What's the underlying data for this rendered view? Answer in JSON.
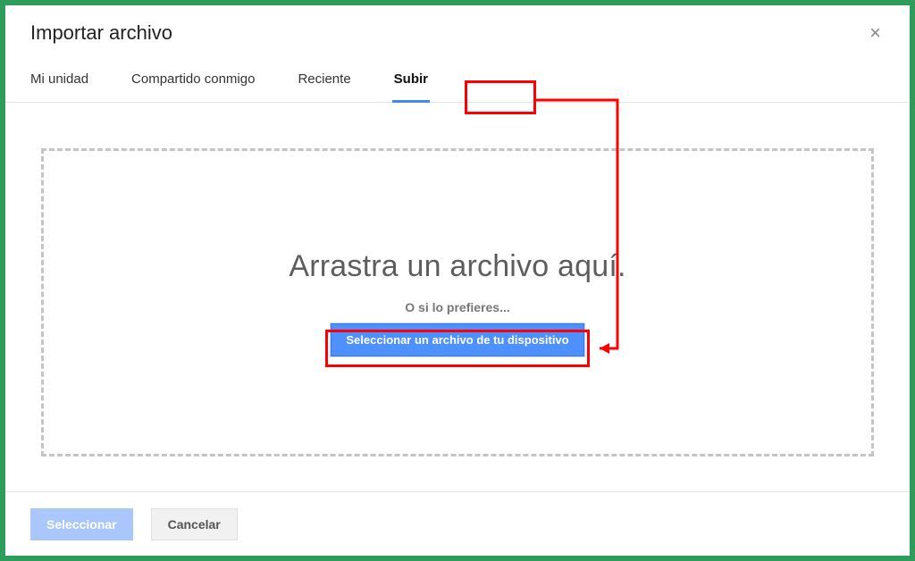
{
  "dialog": {
    "title": "Importar archivo"
  },
  "tabs": {
    "my_drive": "Mi unidad",
    "shared": "Compartido conmigo",
    "recent": "Reciente",
    "upload": "Subir"
  },
  "dropzone": {
    "title": "Arrastra un archivo aquí.",
    "subtitle": "O si lo prefieres...",
    "button": "Seleccionar un archivo de tu dispositivo"
  },
  "footer": {
    "select": "Seleccionar",
    "cancel": "Cancelar"
  },
  "colors": {
    "frame": "#2e9c5a",
    "accent": "#4285f4",
    "annotation": "#ff0000"
  }
}
